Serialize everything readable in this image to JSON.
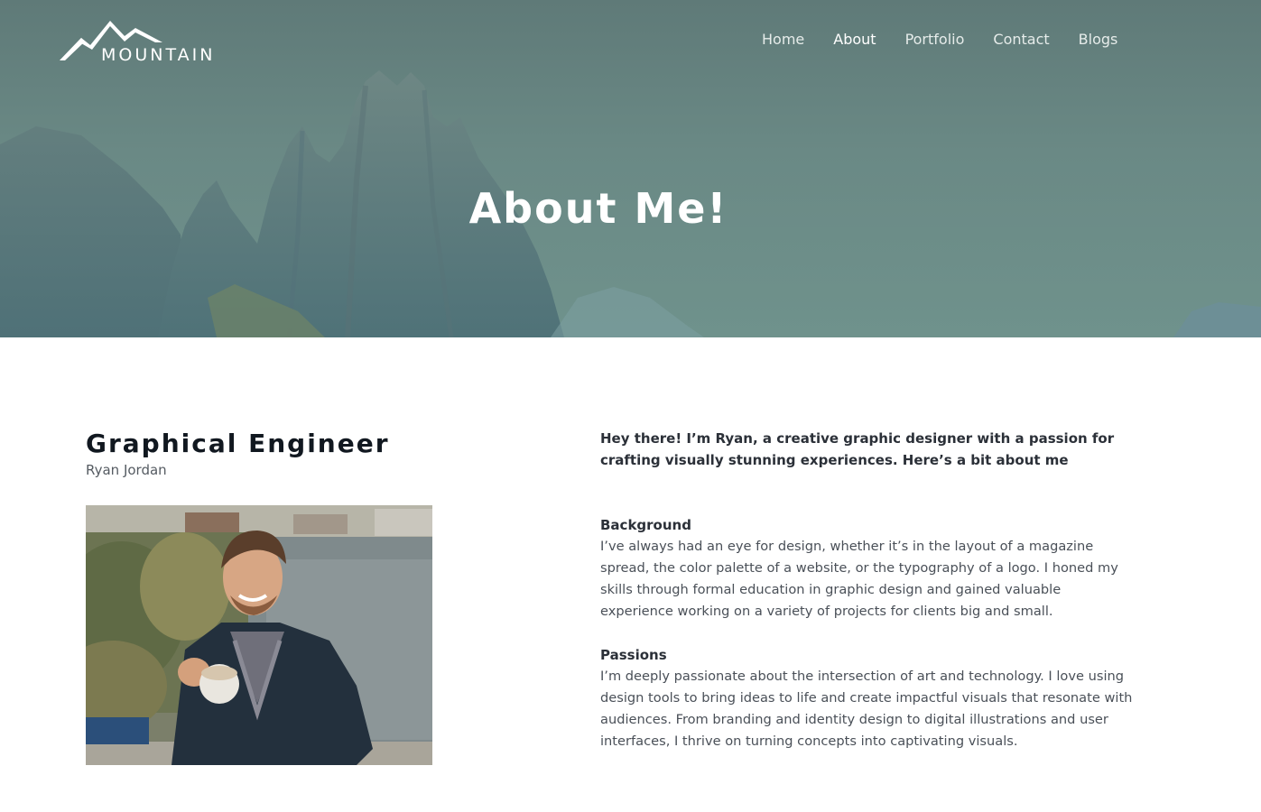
{
  "brand": {
    "name": "MOUNTAIN",
    "logo_icon": "mountain-peaks-icon"
  },
  "nav": {
    "items": [
      {
        "label": "Home",
        "active": false
      },
      {
        "label": "About",
        "active": true
      },
      {
        "label": "Portfolio",
        "active": false
      },
      {
        "label": "Contact",
        "active": false
      },
      {
        "label": "Blogs",
        "active": false
      }
    ]
  },
  "hero": {
    "title": "About Me!"
  },
  "profile": {
    "role": "Graphical Engineer",
    "name": "Ryan Jordan",
    "photo_icon": "profile-photo"
  },
  "about": {
    "intro": "Hey there! I’m Ryan, a creative graphic designer with a passion for crafting visually stunning experiences. Here’s a bit about me",
    "sections": [
      {
        "heading": "Background",
        "body": "I’ve always had an eye for design, whether it’s in the layout of a magazine spread, the color palette of a website, or the typography of a logo. I honed my skills through formal education in graphic design and gained valuable experience working on a variety of projects for clients big and small."
      },
      {
        "heading": "Passions",
        "body": "I’m deeply passionate about the intersection of art and technology. I love using design tools to bring ideas to life and create impactful visuals that resonate with audiences. From branding and identity design to digital illustrations and user interfaces, I thrive on turning concepts into captivating visuals."
      }
    ]
  },
  "colors": {
    "hero_overlay": "#6a8985",
    "heading_text": "#111820",
    "body_text": "#4a5058"
  }
}
